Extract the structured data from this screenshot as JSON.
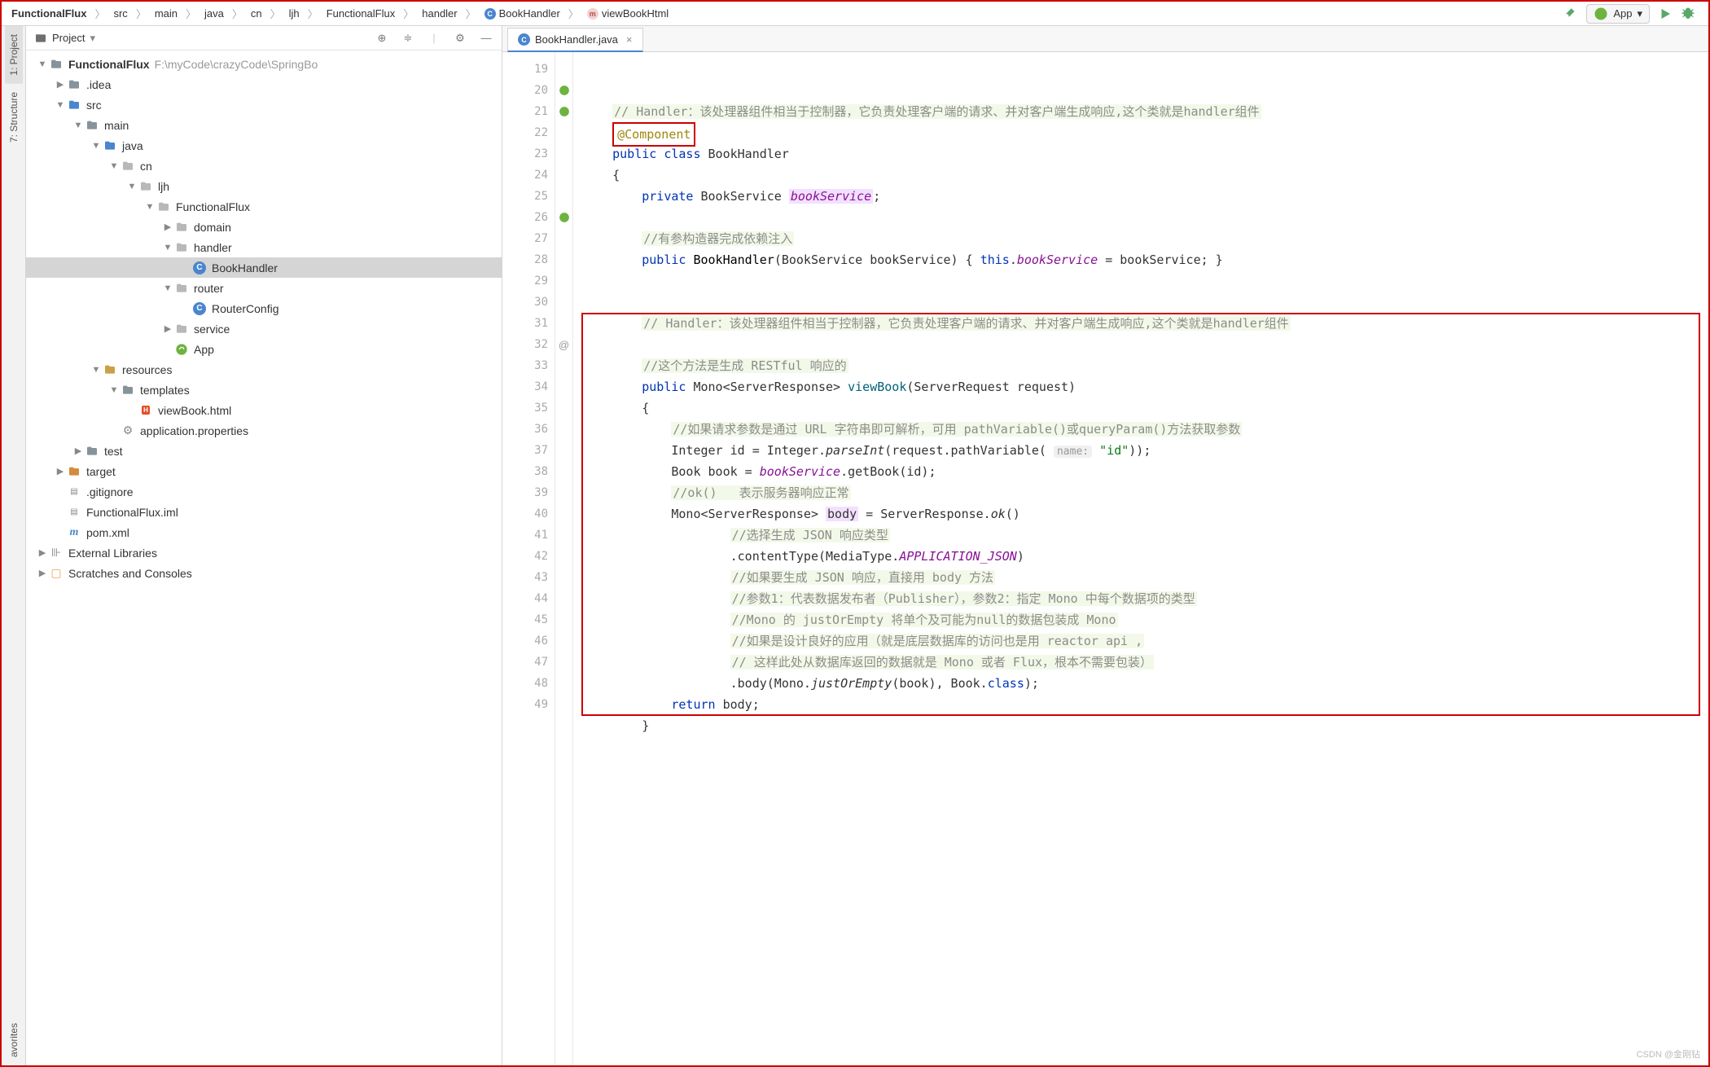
{
  "breadcrumbs": [
    "FunctionalFlux",
    "src",
    "main",
    "java",
    "cn",
    "ljh",
    "FunctionalFlux",
    "handler",
    "BookHandler",
    "viewBookHtml"
  ],
  "breadcrumb_icons": {
    "8": "class",
    "9": "method"
  },
  "run_config": "App",
  "project_panel_title": "Project",
  "tree": [
    {
      "d": 0,
      "arrow": "▼",
      "icon": "folder",
      "label": "FunctionalFlux",
      "path": "F:\\myCode\\crazyCode\\SpringBo",
      "bold": true
    },
    {
      "d": 1,
      "arrow": "▶",
      "icon": "folder",
      "label": ".idea"
    },
    {
      "d": 1,
      "arrow": "▼",
      "icon": "folder-src",
      "label": "src"
    },
    {
      "d": 2,
      "arrow": "▼",
      "icon": "folder",
      "label": "main"
    },
    {
      "d": 3,
      "arrow": "▼",
      "icon": "folder-src",
      "label": "java"
    },
    {
      "d": 4,
      "arrow": "▼",
      "icon": "folder-pkg",
      "label": "cn"
    },
    {
      "d": 5,
      "arrow": "▼",
      "icon": "folder-pkg",
      "label": "ljh"
    },
    {
      "d": 6,
      "arrow": "▼",
      "icon": "folder-pkg",
      "label": "FunctionalFlux"
    },
    {
      "d": 7,
      "arrow": "▶",
      "icon": "folder-pkg",
      "label": "domain"
    },
    {
      "d": 7,
      "arrow": "▼",
      "icon": "folder-pkg",
      "label": "handler"
    },
    {
      "d": 8,
      "arrow": "",
      "icon": "class",
      "label": "BookHandler",
      "selected": true
    },
    {
      "d": 7,
      "arrow": "▼",
      "icon": "folder-pkg",
      "label": "router"
    },
    {
      "d": 8,
      "arrow": "",
      "icon": "class",
      "label": "RouterConfig"
    },
    {
      "d": 7,
      "arrow": "▶",
      "icon": "folder-pkg",
      "label": "service"
    },
    {
      "d": 7,
      "arrow": "",
      "icon": "spring",
      "label": "App"
    },
    {
      "d": 3,
      "arrow": "▼",
      "icon": "folder-res",
      "label": "resources"
    },
    {
      "d": 4,
      "arrow": "▼",
      "icon": "folder",
      "label": "templates"
    },
    {
      "d": 5,
      "arrow": "",
      "icon": "html",
      "label": "viewBook.html"
    },
    {
      "d": 4,
      "arrow": "",
      "icon": "props",
      "label": "application.properties"
    },
    {
      "d": 2,
      "arrow": "▶",
      "icon": "folder",
      "label": "test"
    },
    {
      "d": 1,
      "arrow": "▶",
      "icon": "folder-target",
      "label": "target"
    },
    {
      "d": 1,
      "arrow": "",
      "icon": "gitignore",
      "label": ".gitignore"
    },
    {
      "d": 1,
      "arrow": "",
      "icon": "iml",
      "label": "FunctionalFlux.iml"
    },
    {
      "d": 1,
      "arrow": "",
      "icon": "maven",
      "label": "pom.xml"
    },
    {
      "d": 0,
      "arrow": "▶",
      "icon": "libs",
      "label": "External Libraries"
    },
    {
      "d": 0,
      "arrow": "▶",
      "icon": "scratches",
      "label": "Scratches and Consoles"
    }
  ],
  "open_tab": "BookHandler.java",
  "side_tabs": {
    "project": "1: Project",
    "structure": "7: Structure",
    "favorites": "avorites"
  },
  "line_start": 19,
  "line_end": 49,
  "markers": {
    "20": "spring",
    "21": "spring",
    "26": "spring"
  },
  "gutter_at": {
    "32": "@"
  },
  "code_lines": {
    "19": {
      "type": "cmt",
      "text": "// Handler：该处理器组件相当于控制器，它负责处理客户端的请求、并对客户端生成响应,这个类就是handler组件",
      "indent": 1
    },
    "20": {
      "html": "<span class='red-box-1'><span class='ann'>@Component</span></span>",
      "indent": 1
    },
    "21": {
      "html": "<span class='kw'>public</span> <span class='kw'>class</span> BookHandler",
      "indent": 1
    },
    "22": {
      "text": "{",
      "indent": 1
    },
    "23": {
      "html": "<span class='kw'>private</span> BookService <span class='hl-id field'>bookService</span>;",
      "indent": 2
    },
    "24": {
      "text": "",
      "indent": 2
    },
    "25": {
      "type": "cmt",
      "text": "//有参构造器完成依赖注入",
      "indent": 2
    },
    "26": {
      "html": "<span class='kw'>public</span> <span class='type'>BookHandler</span>(BookService bookService) { <span class='kw'>this</span>.<span class='field'>bookService</span> = bookService; }",
      "indent": 2
    },
    "27": {
      "text": "",
      "indent": 2
    },
    "28": {
      "text": "",
      "indent": 2
    },
    "29": {
      "type": "cmt",
      "text": "// Handler：该处理器组件相当于控制器，它负责处理客户端的请求、并对客户端生成响应,这个类就是handler组件",
      "indent": 2
    },
    "30": {
      "text": "",
      "indent": 2
    },
    "31": {
      "type": "cmt",
      "text": "//这个方法是生成 RESTful 响应的",
      "indent": 2
    },
    "32": {
      "html": "<span class='kw'>public</span> Mono&lt;ServerResponse&gt; <span class='ann' style='color:#00627a'>viewBook</span>(ServerRequest request)",
      "indent": 2
    },
    "33": {
      "text": "{",
      "indent": 2
    },
    "34": {
      "type": "cmt",
      "text": "//如果请求参数是通过 URL 字符串即可解析，可用 pathVariable()或queryParam()方法获取参数",
      "indent": 3
    },
    "35": {
      "html": "Integer id = Integer.<span class='method-static'>parseInt</span>(request.pathVariable( <span class='hint'>name:</span> <span class='str'>\"id\"</span>));",
      "indent": 3
    },
    "36": {
      "html": "Book book = <span class='field'>bookService</span>.getBook(id);",
      "indent": 3
    },
    "37": {
      "type": "cmt",
      "text": "//ok()   表示服务器响应正常",
      "indent": 3
    },
    "38": {
      "html": "Mono&lt;ServerResponse&gt; <span class='hl-id'>body</span> = ServerResponse.<span class='method-static'>ok</span>()",
      "indent": 3
    },
    "39": {
      "type": "cmt",
      "text": "//选择生成 JSON 响应类型",
      "indent": 5
    },
    "40": {
      "html": ".contentType(MediaType.<span class='const'>APPLICATION_JSON</span>)",
      "indent": 5
    },
    "41": {
      "type": "cmt",
      "text": "//如果要生成 JSON 响应，直接用 body 方法",
      "indent": 5
    },
    "42": {
      "type": "cmt",
      "text": "//参数1：代表数据发布者（Publisher），参数2：指定 Mono 中每个数据项的类型",
      "indent": 5
    },
    "43": {
      "type": "cmt",
      "text": "//Mono 的 justOrEmpty 将单个及可能为null的数据包装成 Mono",
      "indent": 5
    },
    "44": {
      "type": "cmt",
      "text": "//如果是设计良好的应用（就是底层数据库的访问也是用 reactor api ,",
      "indent": 5
    },
    "45": {
      "type": "cmt",
      "text": "// 这样此处从数据库返回的数据就是 Mono 或者 Flux，根本不需要包装）",
      "indent": 5
    },
    "46": {
      "html": ".body(Mono.<span class='method-static'>justOrEmpty</span>(book), Book.<span class='kw'>class</span>);",
      "indent": 5
    },
    "47": {
      "html": "<span class='kw'>return</span> body;",
      "indent": 3
    },
    "48": {
      "text": "}",
      "indent": 2
    },
    "49": {
      "text": "",
      "indent": 1
    }
  },
  "watermark": "CSDN @金刚钻"
}
